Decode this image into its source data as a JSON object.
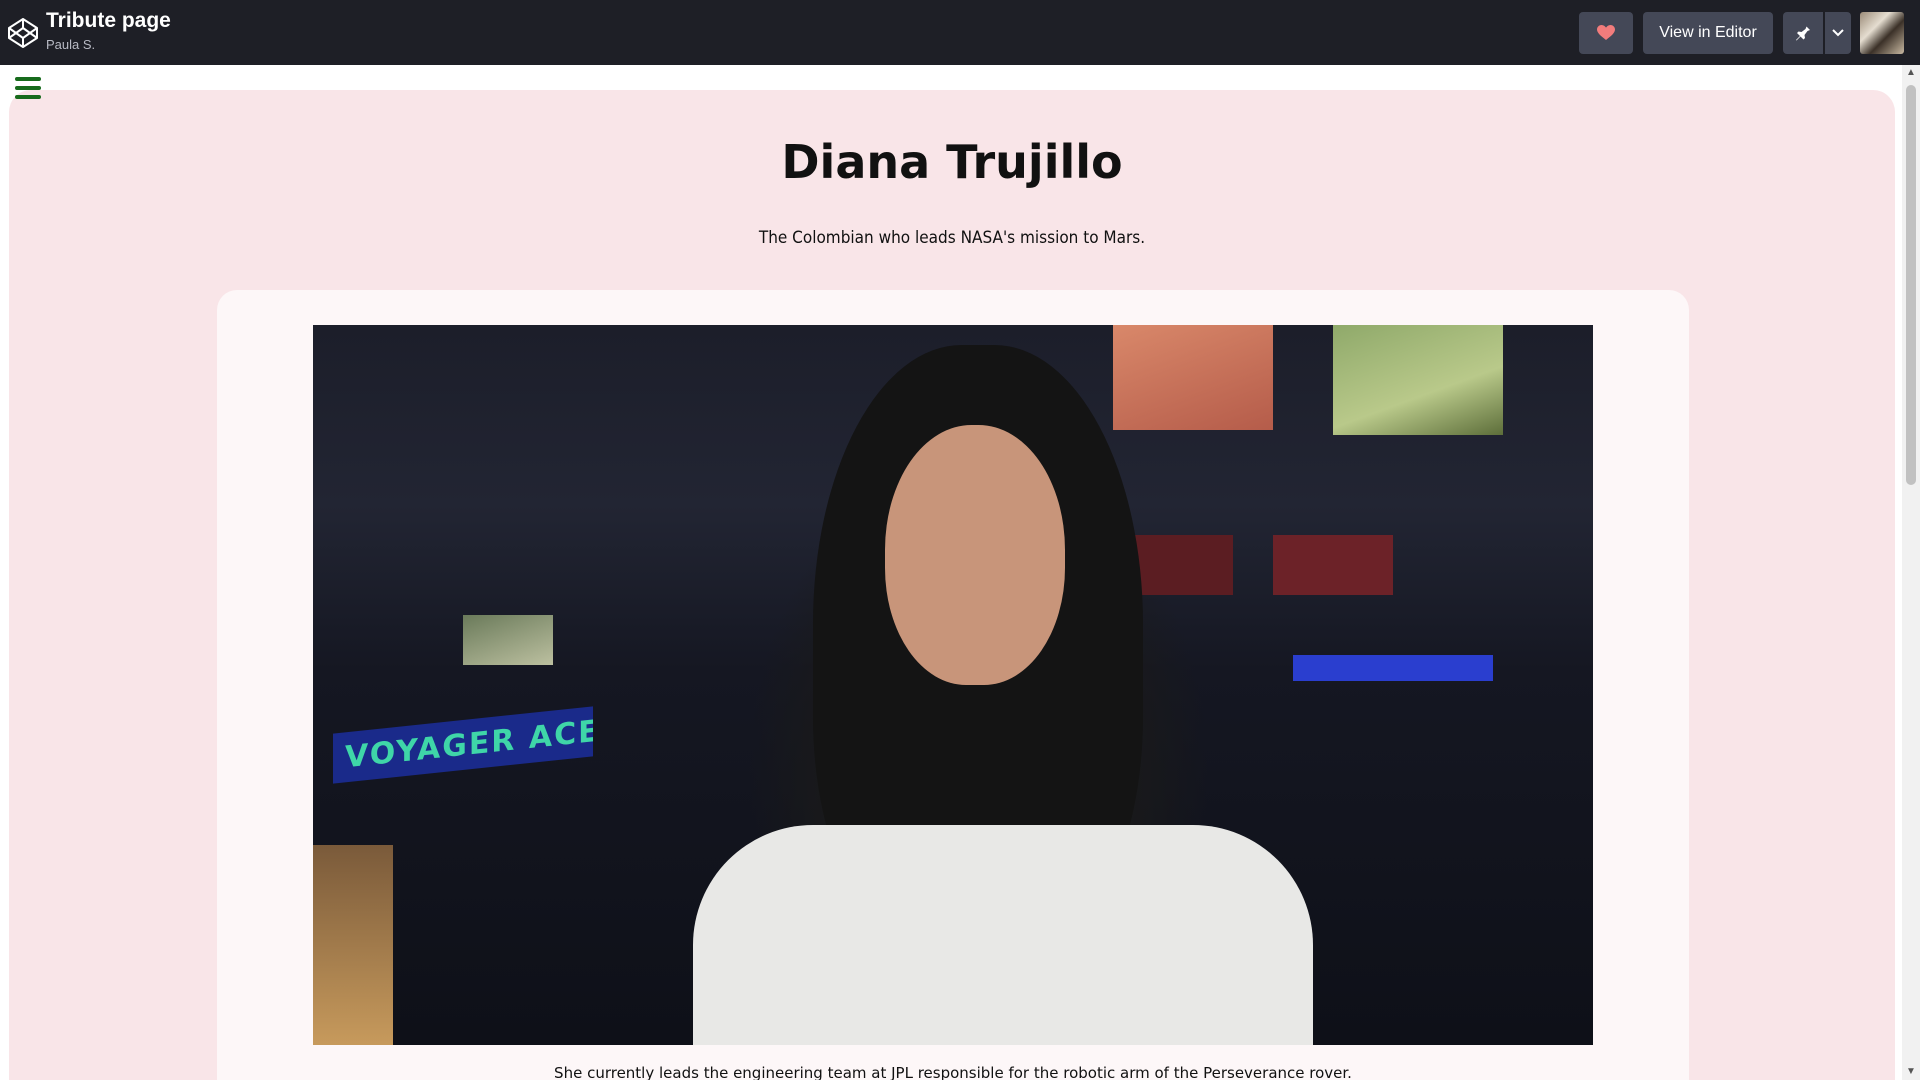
{
  "topbar": {
    "title": "Tribute page",
    "author": "Paula S.",
    "editor_label": "View in Editor",
    "icons": [
      "codepen-logo-icon",
      "heart-icon",
      "pin-icon",
      "chevron-down-icon"
    ]
  },
  "page": {
    "heading": "Diana Trujillo",
    "tagline": "The Colombian who leads NASA's mission to Mars.",
    "caption": "She currently leads the engineering team at JPL responsible for the robotic arm of the Perseverance rover."
  },
  "photo": {
    "overlay_text": "VOYAGER ACE"
  },
  "colors": {
    "topbar": "#1e1f26",
    "button": "#444857",
    "heart": "#f27c7c",
    "menu_icon": "#176b1c",
    "page_background": "#f9e5e8",
    "card": "#fdf7f8"
  }
}
